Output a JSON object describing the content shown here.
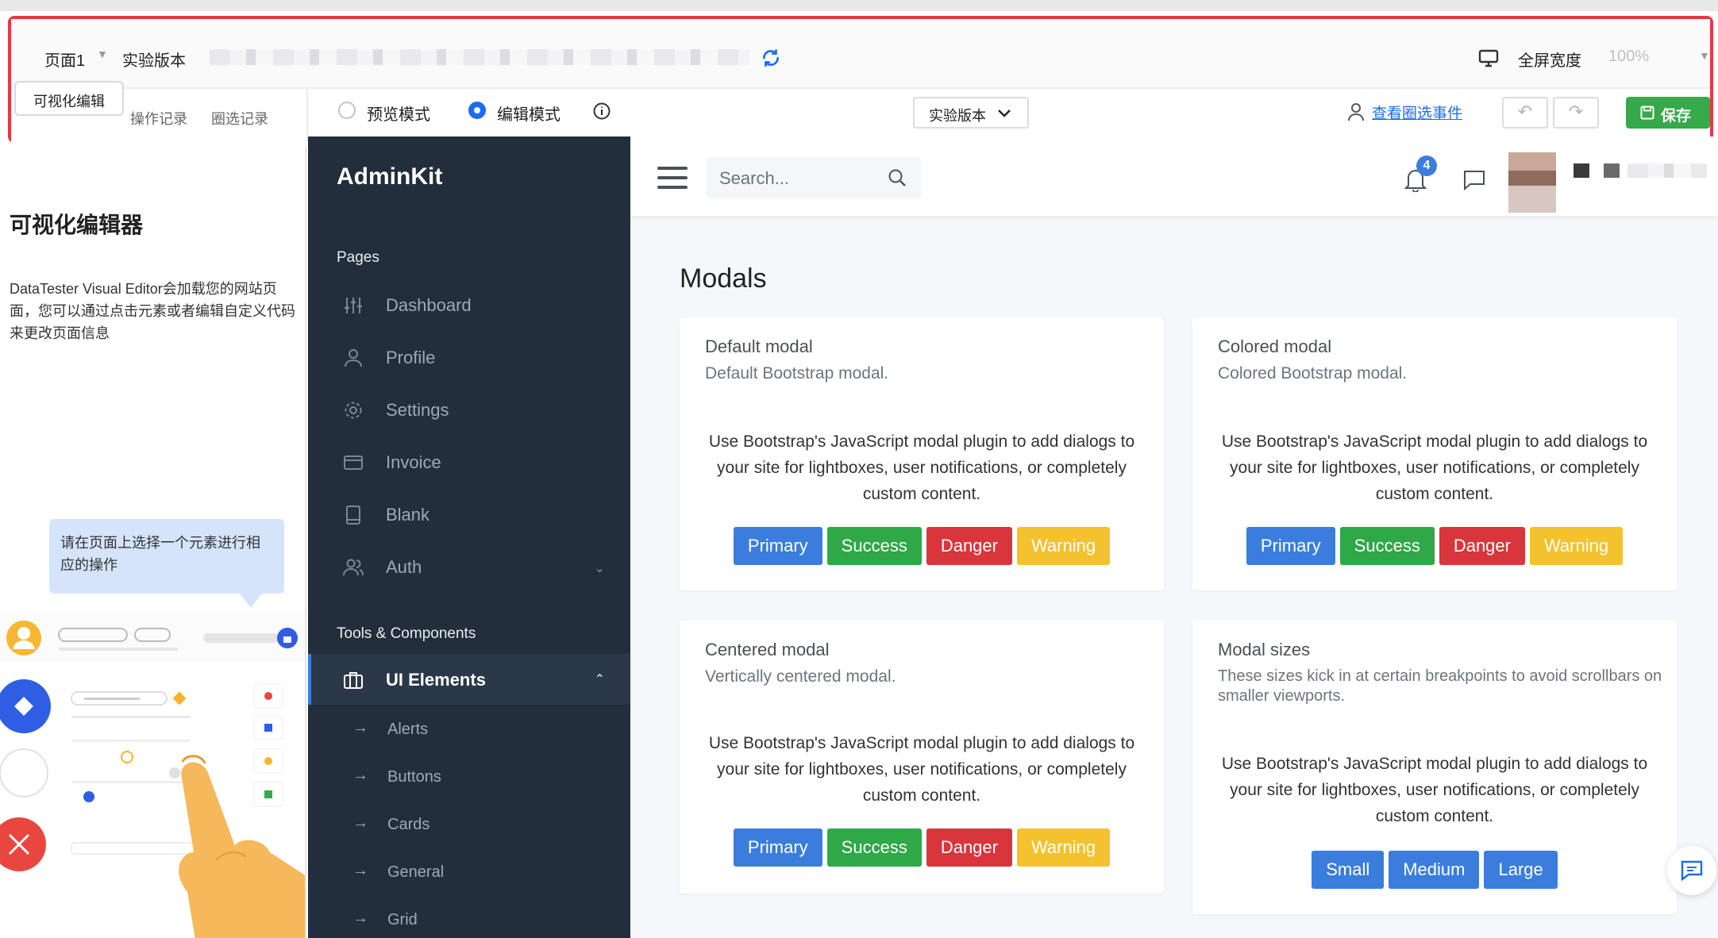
{
  "toolbar": {
    "page_select": "页面1",
    "version_label": "实验版本",
    "fullscreen_label": "全屏宽度",
    "zoom": "100%",
    "tabs": [
      "可视化编辑",
      "操作记录",
      "圈选记录"
    ],
    "mode_preview": "预览模式",
    "mode_edit": "编辑模式",
    "version_select": "实验版本",
    "view_events": "查看圈选事件",
    "save": "保存"
  },
  "left_panel": {
    "title": "可视化编辑器",
    "description": "DataTester Visual Editor会加载您的网站页面，您可以通过点击元素或者编辑自定义代码来更改页面信息",
    "hint": "请在页面上选择一个元素进行相应的操作"
  },
  "sidebar": {
    "brand": "AdminKit",
    "section_pages": "Pages",
    "pages": [
      {
        "label": "Dashboard",
        "icon": "sliders-icon"
      },
      {
        "label": "Profile",
        "icon": "user-icon"
      },
      {
        "label": "Settings",
        "icon": "gear-icon"
      },
      {
        "label": "Invoice",
        "icon": "credit-card-icon"
      },
      {
        "label": "Blank",
        "icon": "book-icon"
      },
      {
        "label": "Auth",
        "icon": "users-icon"
      }
    ],
    "section_tools": "Tools & Components",
    "active": {
      "label": "UI Elements",
      "icon": "briefcase-icon"
    },
    "sub_items": [
      "Alerts",
      "Buttons",
      "Cards",
      "General",
      "Grid"
    ]
  },
  "topnav": {
    "search_placeholder": "Search...",
    "notification_count": "4"
  },
  "main": {
    "title": "Modals",
    "body_text": "Use Bootstrap's JavaScript modal plugin to add dialogs to your site for lightboxes, user notifications, or completely custom content.",
    "cards": [
      {
        "title": "Default modal",
        "subtitle": "Default Bootstrap modal.",
        "buttons": [
          "Primary",
          "Success",
          "Danger",
          "Warning"
        ]
      },
      {
        "title": "Colored modal",
        "subtitle": "Colored Bootstrap modal.",
        "buttons": [
          "Primary",
          "Success",
          "Danger",
          "Warning"
        ]
      },
      {
        "title": "Centered modal",
        "subtitle": "Vertically centered modal.",
        "buttons": [
          "Primary",
          "Success",
          "Danger",
          "Warning"
        ]
      },
      {
        "title": "Modal sizes",
        "subtitle": "These sizes kick in at certain breakpoints to avoid scrollbars on smaller viewports.",
        "buttons": [
          "Small",
          "Medium",
          "Large"
        ]
      }
    ]
  },
  "colors": {
    "highlight_border": "#e5393f",
    "primary": "#3b7ddd",
    "success": "#2fa848",
    "danger": "#d9353c",
    "warning": "#f4c22e",
    "sidebar_bg": "#222e3c",
    "save_green": "#36a94a"
  }
}
